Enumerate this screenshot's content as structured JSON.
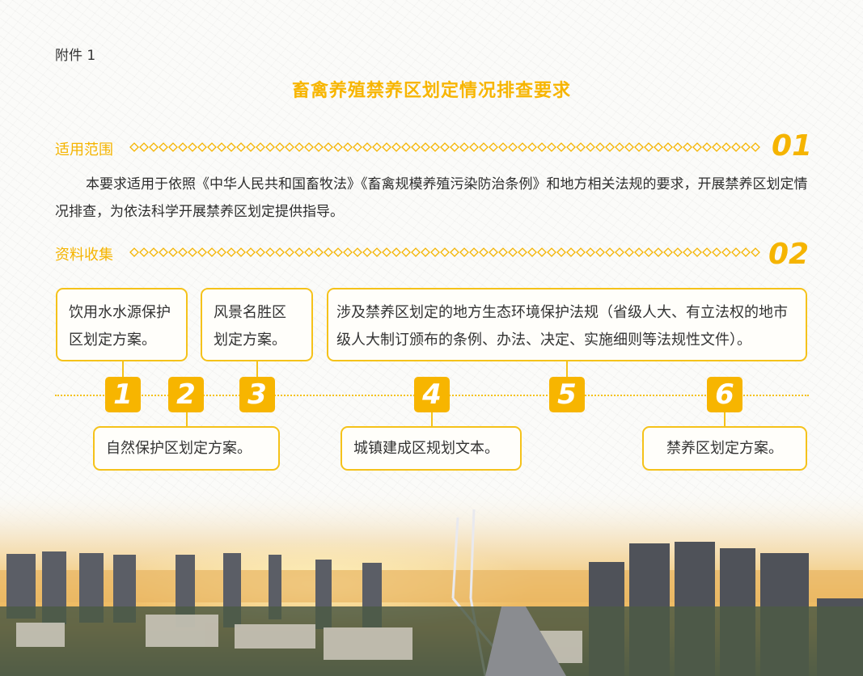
{
  "header": {
    "attachment": "附件 1",
    "title": "畜禽养殖禁养区划定情况排查要求"
  },
  "sections": [
    {
      "title": "适用范围",
      "number": "01",
      "text": "本要求适用于依照《中华人民共和国畜牧法》《畜禽规模养殖污染防治条例》和地方相关法规的要求，开展禁养区划定情况排查，为依法科学开展禁养区划定提供指导。"
    },
    {
      "title": "资料收集",
      "number": "02"
    }
  ],
  "items": [
    {
      "num": "1",
      "text": "饮用水水源保护区划定方案。"
    },
    {
      "num": "2",
      "text": "自然保护区划定方案。"
    },
    {
      "num": "3",
      "text": "风景名胜区划定方案。"
    },
    {
      "num": "4",
      "text": "城镇建成区规划文本。"
    },
    {
      "num": "5",
      "text": "涉及禁养区划定的地方生态环境保护法规（省级人大、有立法权的地市级人大制订颁布的条例、办法、决定、实施细则等法规性文件）。"
    },
    {
      "num": "6",
      "text": "禁养区划定方案。"
    }
  ],
  "colors": {
    "accent": "#f5b400",
    "badge": "#f7b500",
    "text": "#2e2e2e"
  }
}
